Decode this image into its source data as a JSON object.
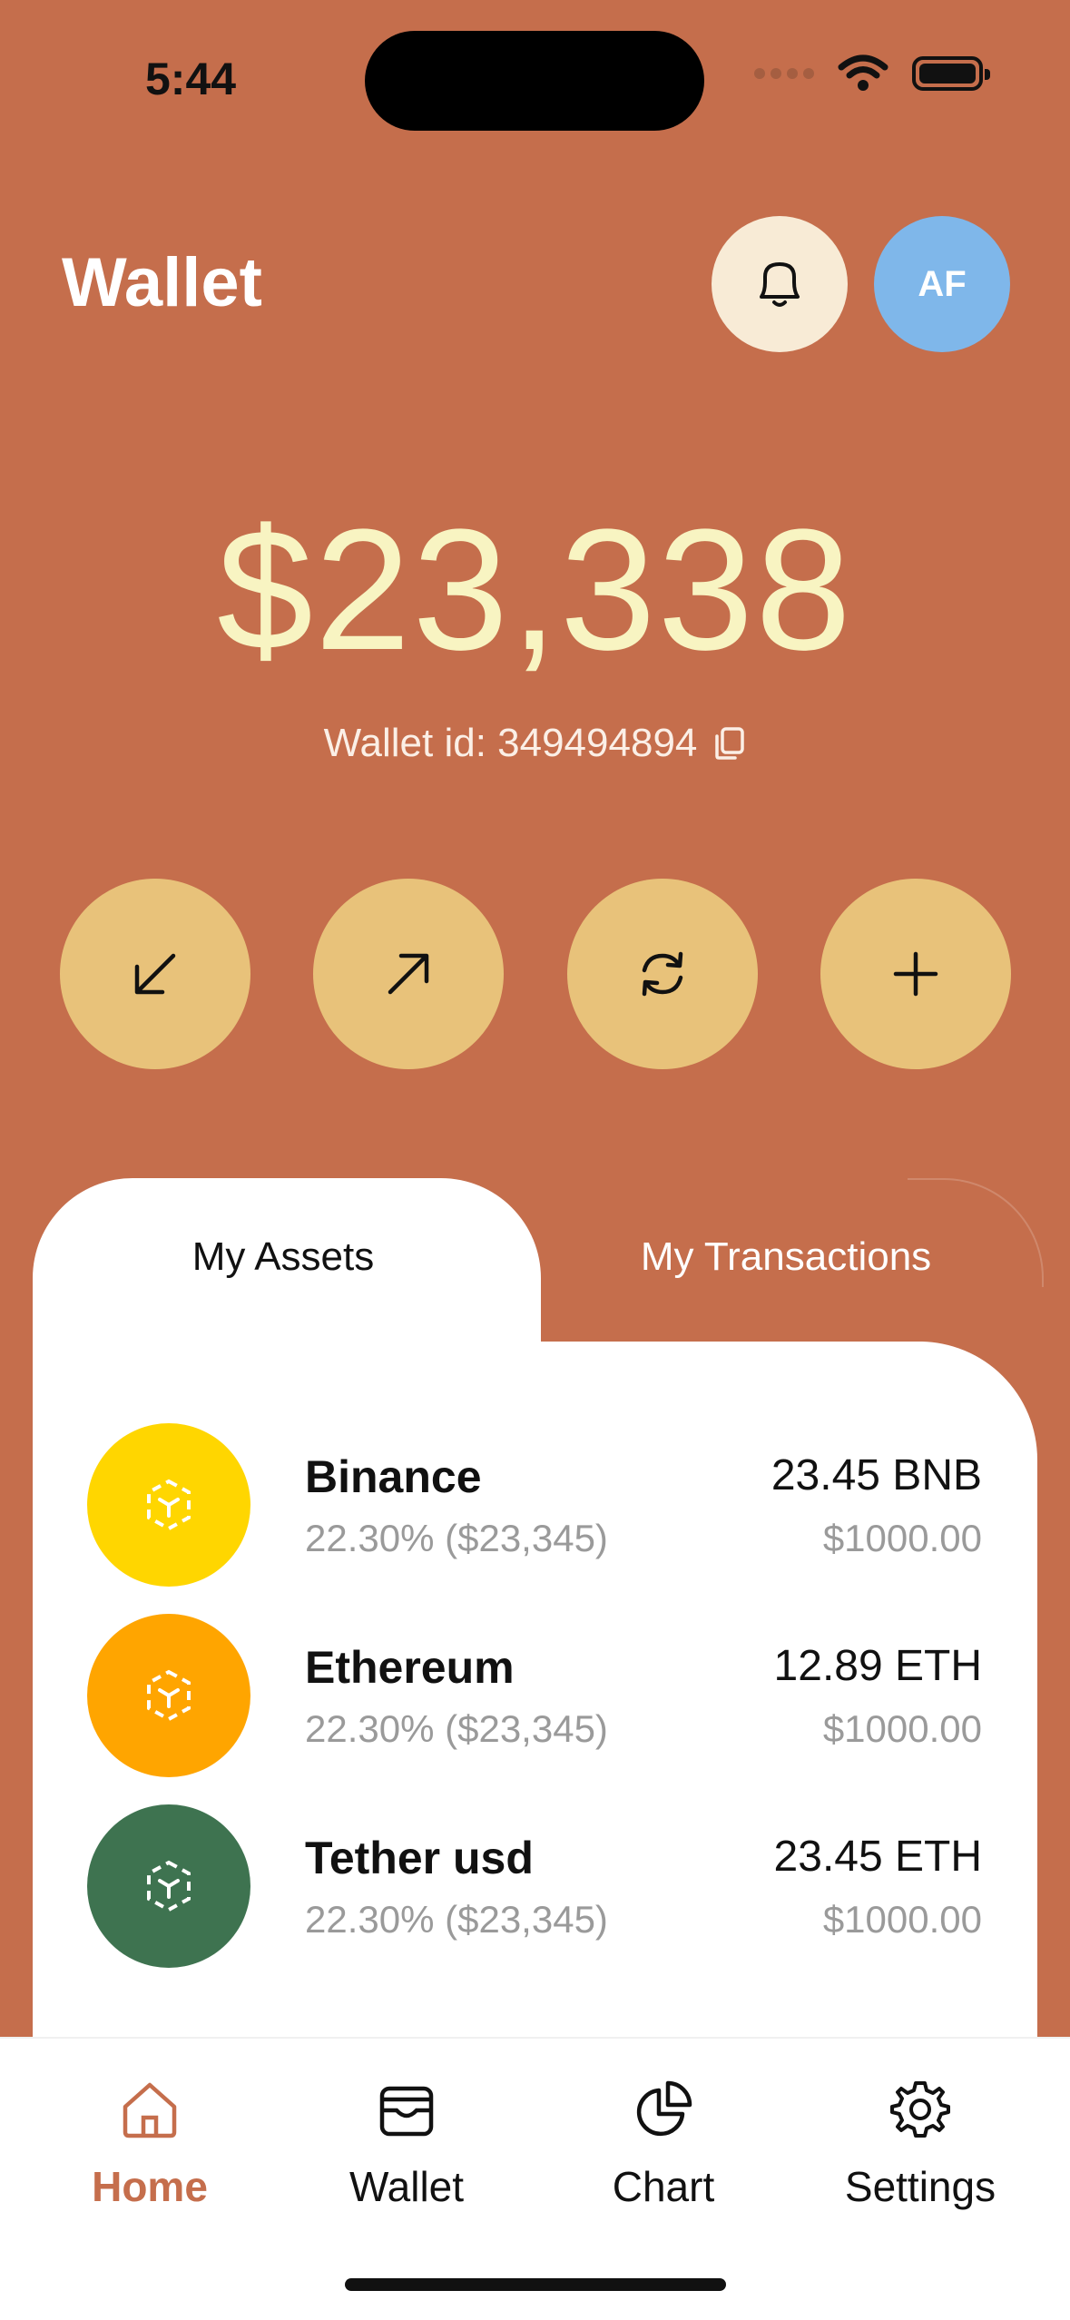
{
  "status_bar": {
    "time": "5:44"
  },
  "header": {
    "title": "Wallet",
    "avatar_initials": "AF"
  },
  "balance": {
    "amount": "$23,338",
    "wallet_id": "Wallet id: 349494894"
  },
  "actions": [
    {
      "name": "receive",
      "icon": "arrow-down-left-icon"
    },
    {
      "name": "send",
      "icon": "arrow-up-right-icon"
    },
    {
      "name": "swap",
      "icon": "refresh-icon"
    },
    {
      "name": "add",
      "icon": "plus-icon"
    }
  ],
  "tabs": {
    "assets": "My Assets",
    "transactions": "My Transactions",
    "active": "assets"
  },
  "assets": [
    {
      "name": "Binance",
      "share": "22.30% ($23,345)",
      "amount": "23.45 BNB",
      "value": "$1000.00",
      "color": "#FFD600"
    },
    {
      "name": "Ethereum",
      "share": "22.30% ($23,345)",
      "amount": "12.89 ETH",
      "value": "$1000.00",
      "color": "#FFA500"
    },
    {
      "name": "Tether usd",
      "share": "22.30% ($23,345)",
      "amount": "23.45 ETH",
      "value": "$1000.00",
      "color": "#3E7350"
    }
  ],
  "nav": [
    {
      "label": "Home",
      "icon": "home-icon",
      "active": true
    },
    {
      "label": "Wallet",
      "icon": "wallet-icon",
      "active": false
    },
    {
      "label": "Chart",
      "icon": "pie-chart-icon",
      "active": false
    },
    {
      "label": "Settings",
      "icon": "gear-icon",
      "active": false
    }
  ],
  "colors": {
    "background": "#C56E4C",
    "balance_text": "#F8F4C2",
    "action_button": "#E8C27A",
    "avatar": "#7FB7EA",
    "accent": "#C56E4C"
  }
}
